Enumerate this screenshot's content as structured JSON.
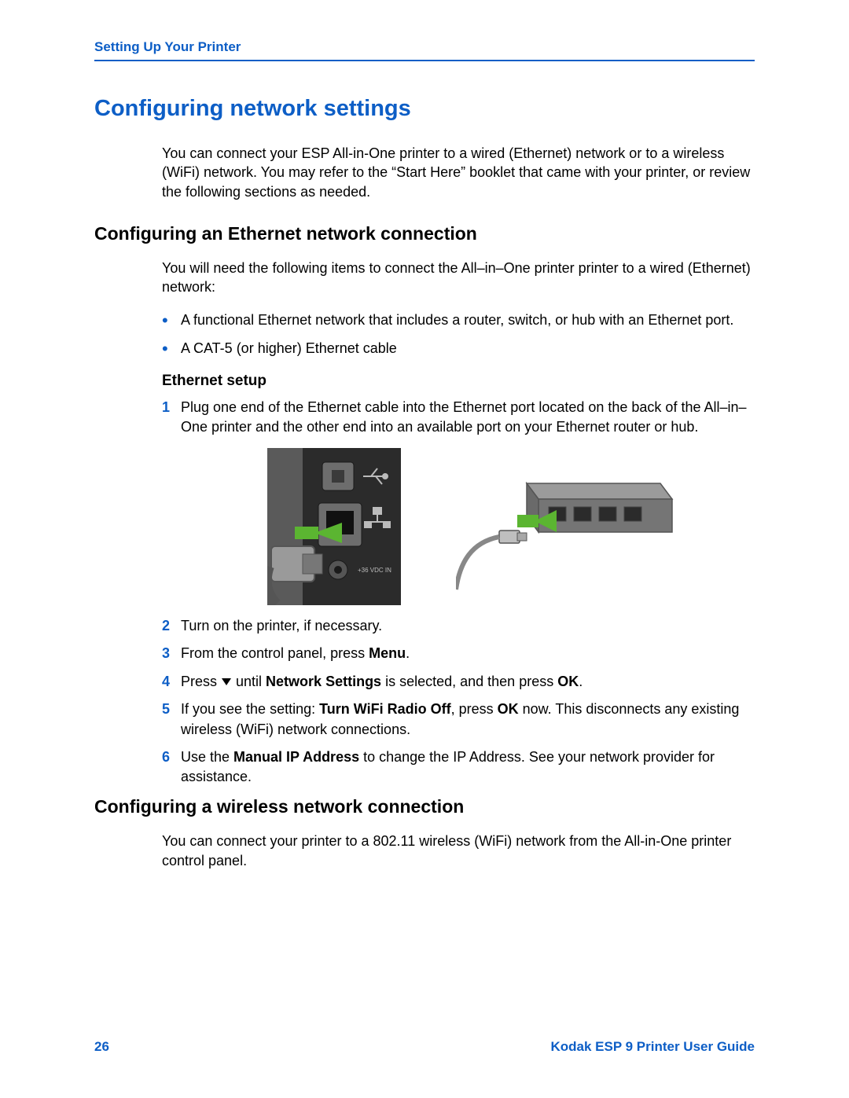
{
  "header": {
    "section_title": "Setting Up Your Printer"
  },
  "h1": "Configuring network settings",
  "intro": "You can connect your ESP All-in-One printer to a wired (Ethernet) network or to a wireless (WiFi) network. You may refer to the “Start Here” booklet that came with your printer, or review the following sections as needed.",
  "h2_ethernet": "Configuring an Ethernet network connection",
  "ethernet_intro": "You will need the following items to connect the All–in–One printer printer to a wired (Ethernet) network:",
  "ethernet_bullets": [
    "A functional Ethernet network that includes a router, switch, or hub with an Ethernet port.",
    "A CAT-5 (or higher) Ethernet cable"
  ],
  "h3_ethernet_setup": "Ethernet setup",
  "steps": {
    "s1": "Plug one end of the Ethernet cable into the Ethernet port located on the back of the All–in–One printer and the other end into an available port on your Ethernet router or hub.",
    "s2": "Turn on the printer, if necessary.",
    "s3_pre": " From the control panel, press ",
    "s3_bold": "Menu",
    "s3_post": ".",
    "s4_pre": "Press ",
    "s4_mid1": " until ",
    "s4_bold1": "Network Settings",
    "s4_mid2": " is selected, and then press ",
    "s4_bold2": "OK",
    "s4_post": ".",
    "s5_pre": "If you see the setting: ",
    "s5_bold1": "Turn WiFi Radio Off",
    "s5_mid": ", press ",
    "s5_bold2": "OK",
    "s5_post": " now. This disconnects any existing wireless (WiFi) network connections.",
    "s6_pre": " Use the ",
    "s6_bold": "Manual IP Address",
    "s6_post": " to change the IP Address. See your network provider for assistance."
  },
  "h2_wireless": "Configuring a wireless network connection",
  "wireless_intro": "You can connect your printer to a 802.11 wireless (WiFi) network from the All-in-One printer control panel.",
  "footer": {
    "page_number": "26",
    "doc_title": "Kodak ESP 9 Printer User Guide"
  }
}
